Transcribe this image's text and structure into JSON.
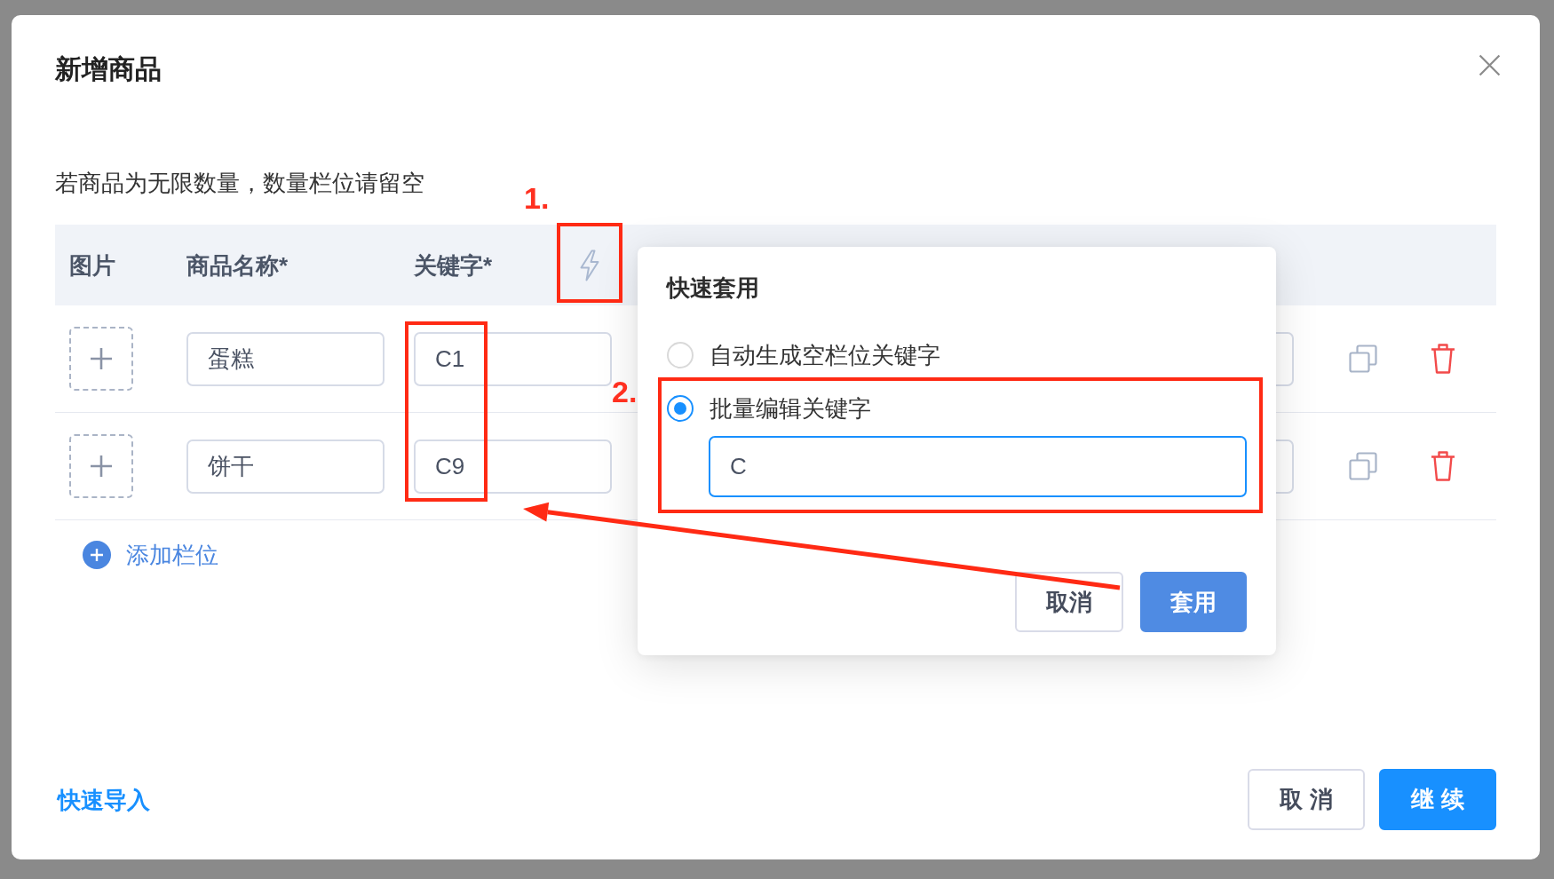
{
  "dialog": {
    "title": "新增商品",
    "hint": "若商品为无限数量，数量栏位请留空"
  },
  "table": {
    "columns": [
      "图片",
      "商品名称*",
      "关键字*"
    ],
    "rows": [
      {
        "name": "蛋糕",
        "keyword": "C1"
      },
      {
        "name": "饼干",
        "keyword": "C9"
      }
    ],
    "add_row": "添加栏位"
  },
  "popover": {
    "title": "快速套用",
    "options": [
      {
        "label": "自动生成空栏位关键字",
        "selected": false
      },
      {
        "label": "批量编辑关键字",
        "selected": true,
        "field": {
          "value": "C"
        }
      }
    ],
    "buttons": [
      {
        "label": "取消",
        "kind": "default"
      },
      {
        "label": "套用",
        "kind": "primary"
      }
    ]
  },
  "footer": {
    "link": "快速导入",
    "buttons": [
      {
        "label": "取 消",
        "kind": "default"
      },
      {
        "label": "继 续",
        "kind": "primary"
      }
    ]
  },
  "annotations": [
    {
      "label": "1."
    },
    {
      "label": "2."
    }
  ]
}
